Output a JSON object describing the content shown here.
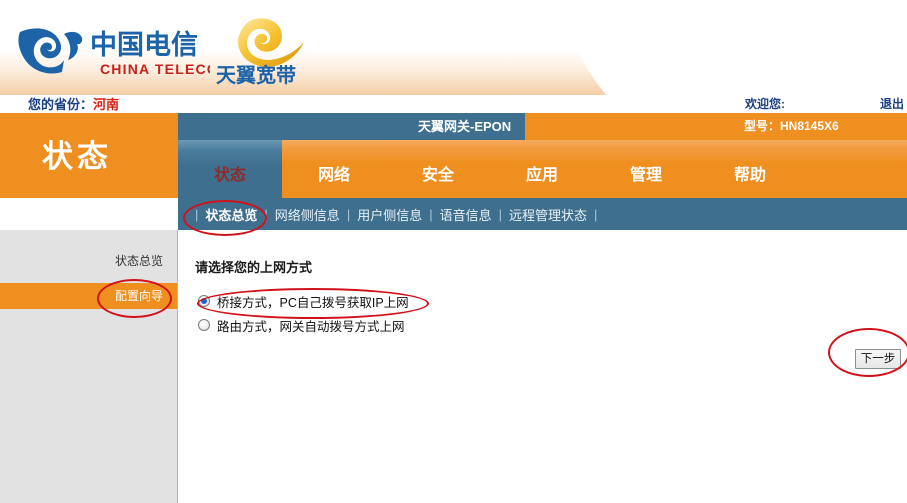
{
  "header": {
    "brand_cn": "中国电信",
    "brand_en": "CHINA TELECOM",
    "sub_brand": "天翼宽带",
    "province_label": "您的省份：",
    "province_value": "河南",
    "welcome": "欢迎您:",
    "logout": "退出",
    "gateway_name": "天翼网关-EPON",
    "model_label": "型号：",
    "model_value": "HN8145X6",
    "model_text": "型号：HN8145X6"
  },
  "colors": {
    "orange": "#ef8f1f",
    "steel_blue": "#3e6f8e",
    "active_tab_text": "#8d2b2b",
    "annotation_red": "#d1121a",
    "province_red": "#d81f0f",
    "nav_blue_text": "#1b3f82",
    "sidebar_gray": "#e2e2e2"
  },
  "page_title": "状态",
  "tabs": [
    {
      "label": "状态",
      "active": true
    },
    {
      "label": "网络",
      "active": false
    },
    {
      "label": "安全",
      "active": false
    },
    {
      "label": "应用",
      "active": false
    },
    {
      "label": "管理",
      "active": false
    },
    {
      "label": "帮助",
      "active": false
    }
  ],
  "subnav": [
    {
      "label": "状态总览",
      "active": true
    },
    {
      "label": "网络侧信息",
      "active": false
    },
    {
      "label": "用户侧信息",
      "active": false
    },
    {
      "label": "语音信息",
      "active": false
    },
    {
      "label": "远程管理状态",
      "active": false
    }
  ],
  "sidebar": {
    "items": [
      {
        "label": "状态总览",
        "active": false
      },
      {
        "label": "配置向导",
        "active": true
      }
    ]
  },
  "main": {
    "title": "请选择您的上网方式",
    "options": [
      {
        "label": "桥接方式，PC自己拨号获取IP上网",
        "selected": true
      },
      {
        "label": "路由方式，网关自动拨号方式上网",
        "selected": false
      }
    ],
    "next_button": "下一步"
  }
}
